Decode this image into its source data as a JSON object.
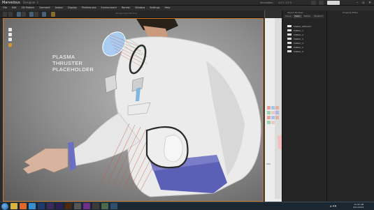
{
  "window": {
    "app_title": "Marvelous",
    "version": "Designer 3",
    "sim_label": "Simulation",
    "sim_values": "1.0  1  1.0  5"
  },
  "menu": [
    "File",
    "Edit",
    "2D Pattern",
    "Garment",
    "Avatar",
    "Display",
    "Preferences",
    "Environment",
    "Render",
    "Window",
    "Settings",
    "Help"
  ],
  "toolbar": {
    "viewport_label": "3D Garment Window"
  },
  "viewport": {
    "annotation_lines": [
      "PLASMA",
      "THRUSTER",
      "PLACEHOLDER"
    ],
    "accent": "#c47a2a"
  },
  "pattern_window": {
    "label": "200"
  },
  "object_browser": {
    "title": "Object Browser",
    "tabs": [
      "Scene",
      "Fabric",
      "Button",
      "Topstitch"
    ],
    "items": [
      "FABRIC_DEFAULT",
      "FABRIC_1",
      "FABRIC_2",
      "FABRIC_3",
      "FABRIC_4",
      "FABRIC_5",
      "FABRIC_6"
    ]
  },
  "property_editor": {
    "title": "Property Editor"
  },
  "taskbar": {
    "apps": [
      "explorer",
      "firefox",
      "media",
      "photoshop",
      "premiere",
      "aftereffects",
      "illustrator",
      "unity",
      "marvelous",
      "notepad",
      "viewer",
      "settings"
    ],
    "tray_text": "▲ ◀ ▣",
    "time": "11:42 AM",
    "date": "3/11/2014"
  }
}
